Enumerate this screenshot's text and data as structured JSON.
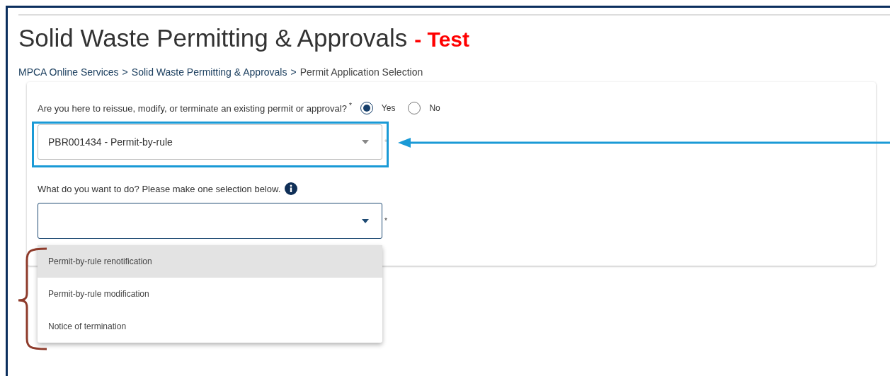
{
  "header": {
    "title": "Solid Waste Permitting & Approvals",
    "environment_tag": "- Test"
  },
  "breadcrumb": {
    "separator": ">",
    "items": [
      {
        "label": "MPCA Online Services"
      },
      {
        "label": "Solid Waste Permitting & Approvals"
      },
      {
        "label": "Permit Application Selection"
      }
    ]
  },
  "existing_permit_question": {
    "label": "Are you here to reissue, modify, or terminate an existing permit or approval?",
    "required_mark": "*",
    "options": [
      {
        "label": "Yes",
        "selected": true
      },
      {
        "label": "No",
        "selected": false
      }
    ]
  },
  "permit_select": {
    "value": "PBR001434 - Permit-by-rule",
    "required_mark": "*"
  },
  "action_question": {
    "label": "What do you want to do? Please make one selection below.",
    "required_mark": "*",
    "expanded": true,
    "options": [
      {
        "label": "Permit-by-rule renotification",
        "selected": true
      },
      {
        "label": "Permit-by-rule modification",
        "selected": false
      },
      {
        "label": "Notice of termination",
        "selected": false
      }
    ]
  }
}
